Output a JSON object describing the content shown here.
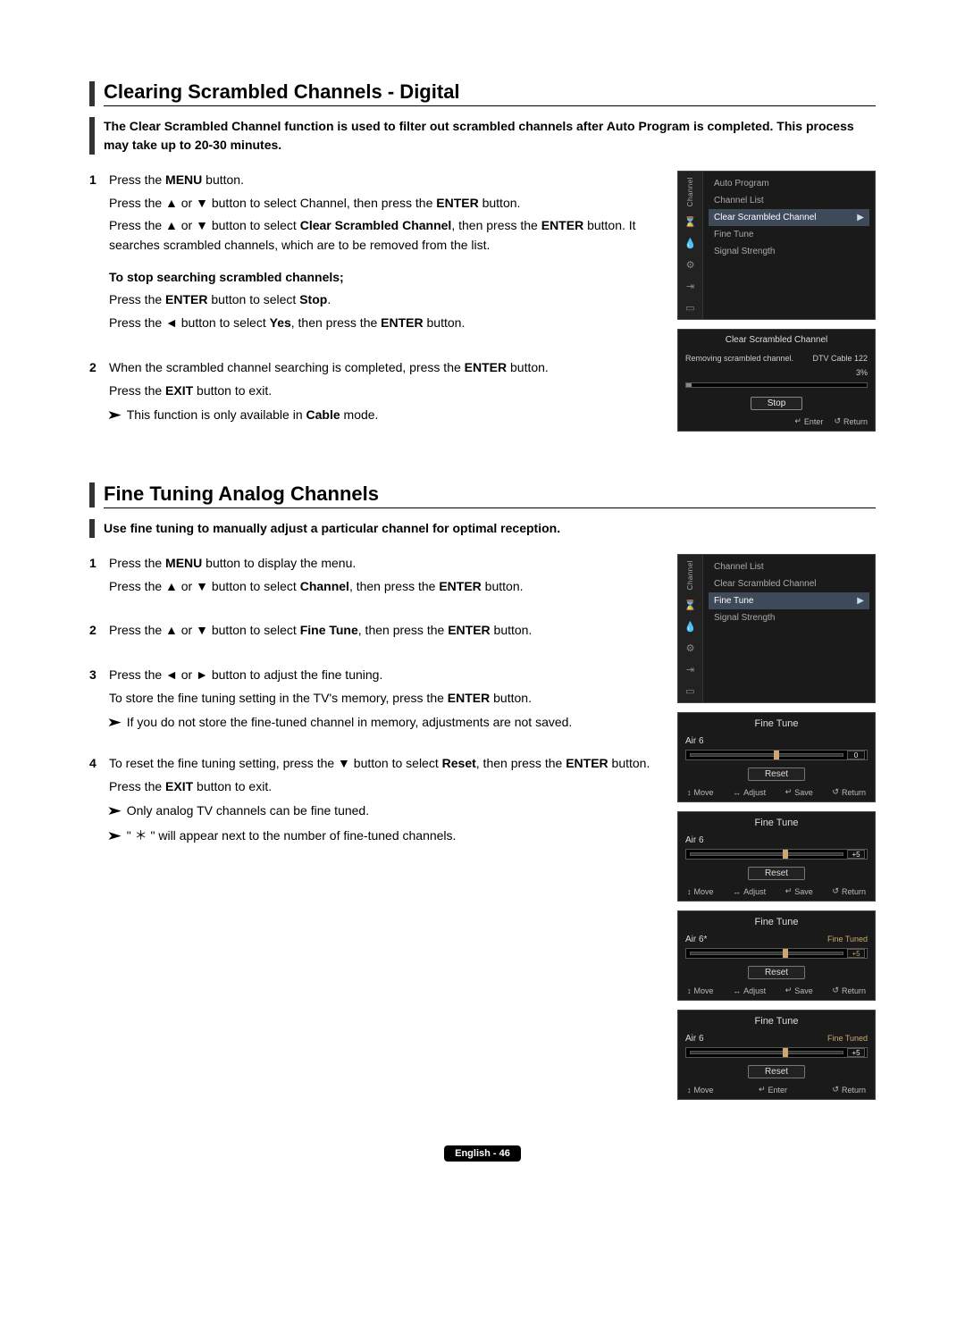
{
  "section1": {
    "title": "Clearing Scrambled Channels - Digital",
    "intro": "The Clear Scrambled Channel function is used to filter out scrambled channels after Auto Program is completed. This process may take up to 20-30 minutes.",
    "steps": [
      {
        "num": "1",
        "lines": [
          [
            "Press the ",
            "MENU",
            " button."
          ],
          [
            "Press the ▲ or ▼ button to select Channel, then press the ",
            "ENTER",
            " button."
          ],
          [
            "Press the ▲ or ▼ button to select ",
            "Clear Scrambled Channel",
            ", then press the ",
            "ENTER",
            " button. It searches scrambled channels, which are to be removed from the list."
          ]
        ],
        "subhead": "To stop searching scrambled channels;",
        "sublines": [
          [
            "Press the ",
            "ENTER",
            " button to select ",
            "Stop",
            "."
          ],
          [
            "Press the ◄ button to select ",
            "Yes",
            ", then press the ",
            "ENTER",
            " button."
          ]
        ]
      },
      {
        "num": "2",
        "lines": [
          [
            "When the scrambled channel searching is completed, press the ",
            "ENTER",
            " button."
          ],
          [
            "Press the ",
            "EXIT",
            " button to exit."
          ]
        ],
        "notes": [
          [
            "This function is only available in ",
            "Cable",
            " mode."
          ]
        ]
      }
    ]
  },
  "section2": {
    "title": "Fine Tuning Analog Channels",
    "intro": "Use fine tuning to manually adjust a particular channel for optimal reception.",
    "steps": [
      {
        "num": "1",
        "lines": [
          [
            "Press the ",
            "MENU",
            " button to display the menu."
          ],
          [
            "Press the ▲ or ▼ button to select ",
            "Channel",
            ", then press the ",
            "ENTER",
            " button."
          ]
        ]
      },
      {
        "num": "2",
        "lines": [
          [
            "Press the ▲ or ▼ button to select ",
            "Fine Tune",
            ", then press the ",
            "ENTER",
            " button."
          ]
        ]
      },
      {
        "num": "3",
        "lines": [
          [
            "Press the ◄ or ► button to adjust the fine tuning."
          ],
          [
            "To store the fine tuning setting in the TV's memory, press the ",
            "ENTER",
            " button."
          ]
        ],
        "notes": [
          [
            "If you do not store the fine-tuned channel in memory, adjustments are not saved."
          ]
        ]
      },
      {
        "num": "4",
        "lines": [
          [
            "To reset the fine tuning setting, press the ▼ button to select ",
            "Reset",
            ", then press the ",
            "ENTER",
            " button."
          ],
          [
            "Press the ",
            "EXIT",
            " button to exit."
          ]
        ],
        "notes": [
          [
            "Only analog TV channels can be fine tuned."
          ],
          [
            "\" ＊ \" will appear next to the number of fine-tuned channels."
          ]
        ]
      }
    ]
  },
  "osd1": {
    "sidebar_label": "Channel",
    "items": [
      "Auto Program",
      "Channel List",
      "Clear Scrambled Channel",
      "Fine Tune",
      "Signal Strength"
    ],
    "selected_index": 2
  },
  "osd2": {
    "title": "Clear Scrambled Channel",
    "msg": "Removing scrambled channel.",
    "right1": "DTV Cable 122",
    "right2": "3%",
    "stop": "Stop",
    "foot_enter_icon": "↵",
    "foot_enter": "Enter",
    "foot_return_icon": "↺",
    "foot_return": "Return"
  },
  "osd3": {
    "sidebar_label": "Channel",
    "items": [
      "Channel List",
      "Clear Scrambled Channel",
      "Fine Tune",
      "Signal Strength"
    ],
    "selected_index": 2
  },
  "tuningPanels": [
    {
      "title": "Fine Tune",
      "channel": "Air 6",
      "status": "",
      "value": "0",
      "value_orange": false,
      "knob_pct": 50,
      "reset": "Reset",
      "foot": [
        "Move",
        "Adjust",
        "Save",
        "Return"
      ],
      "foot_icons": [
        "↕",
        "↔",
        "↵",
        "↺"
      ]
    },
    {
      "title": "Fine Tune",
      "channel": "Air 6",
      "status": "",
      "value": "+5",
      "value_orange": false,
      "knob_pct": 55,
      "reset": "Reset",
      "foot": [
        "Move",
        "Adjust",
        "Save",
        "Return"
      ],
      "foot_icons": [
        "↕",
        "↔",
        "↵",
        "↺"
      ]
    },
    {
      "title": "Fine Tune",
      "channel": "Air 6*",
      "status": "Fine Tuned",
      "value": "+5",
      "value_orange": true,
      "knob_pct": 55,
      "reset": "Reset",
      "foot": [
        "Move",
        "Adjust",
        "Save",
        "Return"
      ],
      "foot_icons": [
        "↕",
        "↔",
        "↵",
        "↺"
      ]
    },
    {
      "title": "Fine Tune",
      "channel": "Air 6",
      "status": "Fine Tuned",
      "value": "+5",
      "value_orange": false,
      "knob_pct": 55,
      "reset": "Reset",
      "foot": [
        "Move",
        "Enter",
        "Return"
      ],
      "foot_icons": [
        "↕",
        "↵",
        "↺"
      ]
    }
  ],
  "footer": {
    "text": "English - 46"
  }
}
